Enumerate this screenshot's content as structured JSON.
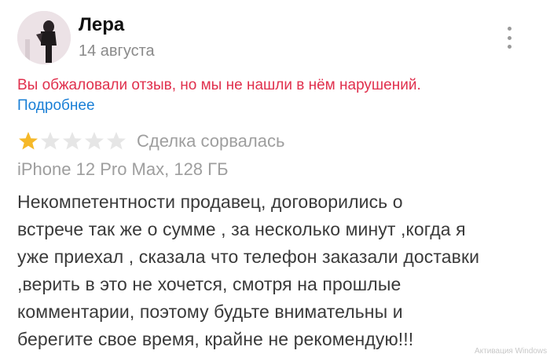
{
  "review": {
    "author_name": "Лера",
    "date": "14 августа",
    "more_icon": "more-vertical-icon",
    "appeal_notice": "Вы обжаловали отзыв, но мы не нашли в нём нарушений.",
    "details_link": "Подробнее",
    "rating": {
      "value": 1,
      "max": 5,
      "filled_color": "#f5b828",
      "empty_color": "#e6e6e6"
    },
    "deal_status": "Сделка сорвалась",
    "product": "iPhone 12 Pro Max, 128 ГБ",
    "body_lines": [
      "Некомпетентности продавец, договорились о",
      "встрече так же о сумме , за несколько минут ,когда я",
      "уже приехал , сказала что телефон заказали доставки",
      ",верить в это не хочется, смотря на прошлые",
      "комментарии, поэтому будьте внимательны и",
      "берегите свое время, крайне не рекомендую!!!"
    ]
  },
  "overlay": {
    "watermark": "Активация Windows"
  },
  "colors": {
    "appeal_text": "#e0304d",
    "link": "#1a7fd6",
    "muted": "#9e9e9e"
  }
}
